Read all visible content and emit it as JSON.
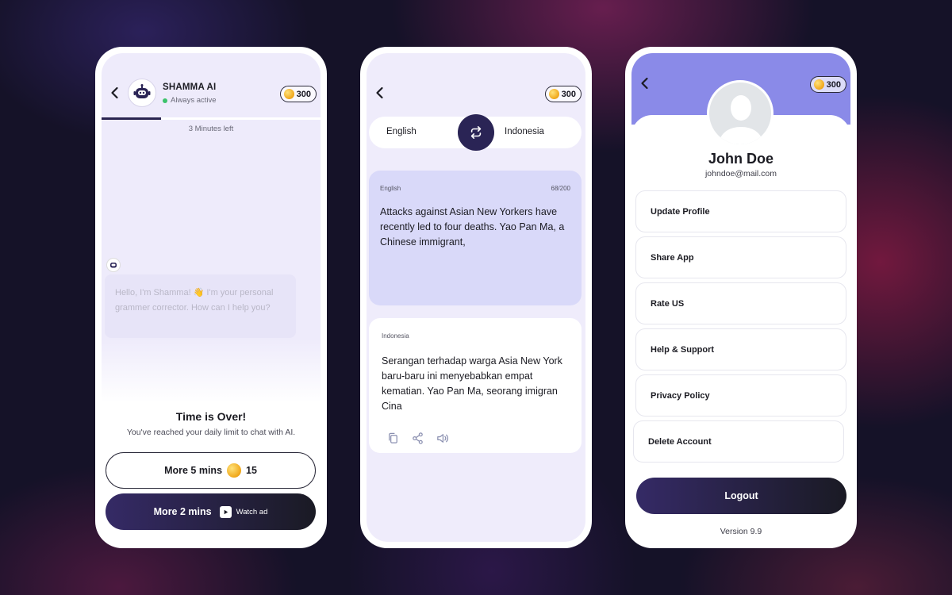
{
  "coins": "300",
  "chat": {
    "bot_name": "SHAMMA AI",
    "status": "Always active",
    "progress_fraction": 0.27,
    "time_left": "3 Minutes left",
    "message": "Hello, I'm Shamma! 👋 I'm your personal grammer corrector. How can I help you?",
    "over_title": "Time is Over!",
    "over_subtitle": "You've reached your daily limit to chat with AI.",
    "more5_label": "More 5 mins",
    "more5_cost": "15",
    "more2_label": "More 2 mins",
    "watch_label": "Watch ad"
  },
  "translate": {
    "source_lang": "English",
    "target_lang": "Indonesia",
    "source_card_lang": "English",
    "char_count": "68/200",
    "source_text": "Attacks against Asian New Yorkers have recently led to four deaths. Yao Pan Ma, a Chinese immigrant,",
    "target_card_lang": "Indonesia",
    "target_text": "Serangan terhadap warga Asia New York baru-baru ini menyebabkan empat kematian. Yao Pan Ma, seorang imigran Cina",
    "tools": [
      "copy-icon",
      "share-icon",
      "speaker-icon"
    ]
  },
  "profile": {
    "name": "John Doe",
    "email": "johndoe@mail.com",
    "menu": [
      "Update Profile",
      "Share App",
      "Rate US",
      "Help & Support",
      "Privacy Policy",
      "Delete Account"
    ],
    "logout": "Logout",
    "version": "Version 9.9"
  },
  "colors": {
    "accent_dark": "#2a2455",
    "header_purple": "#8a8ae8",
    "source_card": "#d9d9f9",
    "screen_bg": "#efecfb",
    "online": "#3cc26b"
  }
}
